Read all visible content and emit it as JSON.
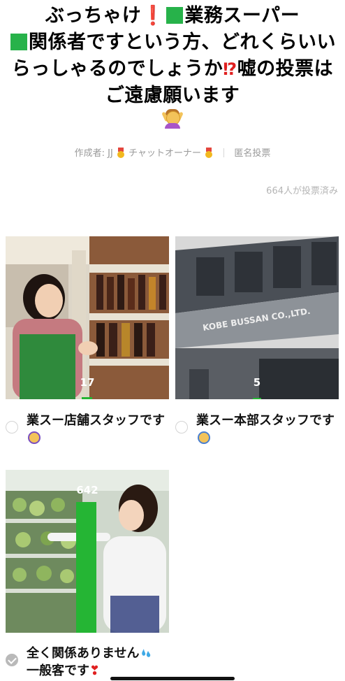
{
  "poll": {
    "title_part1": "ぶっちゃけ",
    "title_part2": "業務スーパー",
    "title_part3": "関係者ですという方、どれくらいいらっしゃるのでしょうか",
    "title_part4": "嘘の投票はご遠慮願います",
    "title_emoji": "person-gesturing-ok-emoji"
  },
  "meta": {
    "creator_label": "作成者: JJ",
    "owner_label": "チャットオーナー",
    "anonymous_label": "匿名投票"
  },
  "voted_count": "664人が投票済み",
  "options": [
    {
      "label": "業スー店舗スタッフです",
      "count": "17",
      "percent": 2.6,
      "selected": false,
      "emoji": "raising-hand-emoji"
    },
    {
      "label": "業スー本部スタッフです",
      "count": "5",
      "percent": 0.8,
      "selected": false,
      "emoji": "raising-hand-emoji"
    },
    {
      "label": "全く関係ありません",
      "label_line2": "一般客です",
      "count": "642",
      "percent": 96.7,
      "selected": true,
      "emoji": "sweat-droplets-emoji"
    }
  ],
  "colors": {
    "bar": "#25b534",
    "accent_red": "#e02020"
  }
}
